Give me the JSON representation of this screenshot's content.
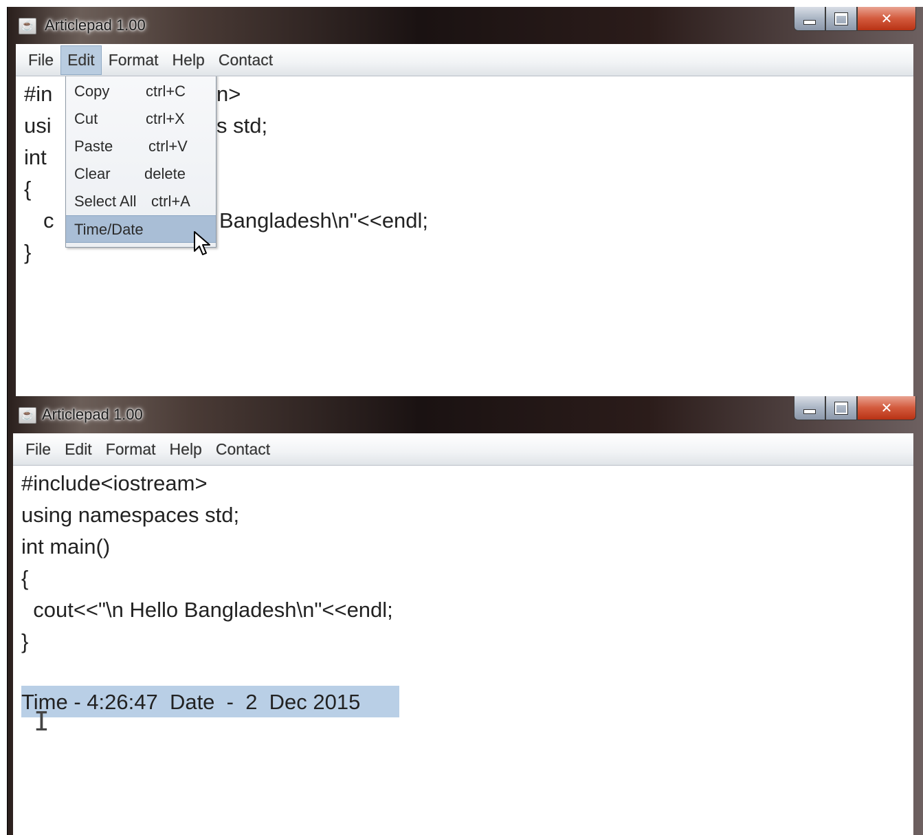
{
  "top_window": {
    "title": "Articlepad 1.00",
    "menu": [
      "File",
      "Edit",
      "Format",
      "Help",
      "Contact"
    ],
    "active_menu": "Edit",
    "visible_code": {
      "line1_left": "#in",
      "line1_right": "n>",
      "line2_left": "usi",
      "line2_right": "s std;",
      "line3_left": "int",
      "line4": "{",
      "line5_left": "c",
      "line5_right": "Bangladesh\\n\"<<endl;",
      "line6": "}"
    },
    "edit_menu": [
      {
        "label": "Copy",
        "shortcut": "ctrl+C"
      },
      {
        "label": "Cut",
        "shortcut": "ctrl+X"
      },
      {
        "label": "Paste",
        "shortcut": "ctrl+V"
      },
      {
        "label": "Clear",
        "shortcut": "delete"
      },
      {
        "label": "Select All",
        "shortcut": "ctrl+A"
      },
      {
        "label": "Time/Date",
        "shortcut": ""
      }
    ]
  },
  "bottom_window": {
    "title": "Articlepad 1.00",
    "menu": [
      "File",
      "Edit",
      "Format",
      "Help",
      "Contact"
    ],
    "code_lines": [
      "#include<iostream>",
      "using namespaces std;",
      "int main()",
      "{",
      "  cout<<\"\\n Hello Bangladesh\\n\"<<endl;",
      "}"
    ],
    "inserted_text": "Time - 4:26:47  Date  -  2  Dec 2015"
  },
  "colors": {
    "selection": "#b9cfe6",
    "menu_highlight": "#a9bed6",
    "close_button": "#d35a3d"
  },
  "icons": [
    "java-app-icon",
    "minimize-icon",
    "maximize-icon",
    "close-icon",
    "mouse-pointer-icon",
    "text-cursor-icon"
  ]
}
